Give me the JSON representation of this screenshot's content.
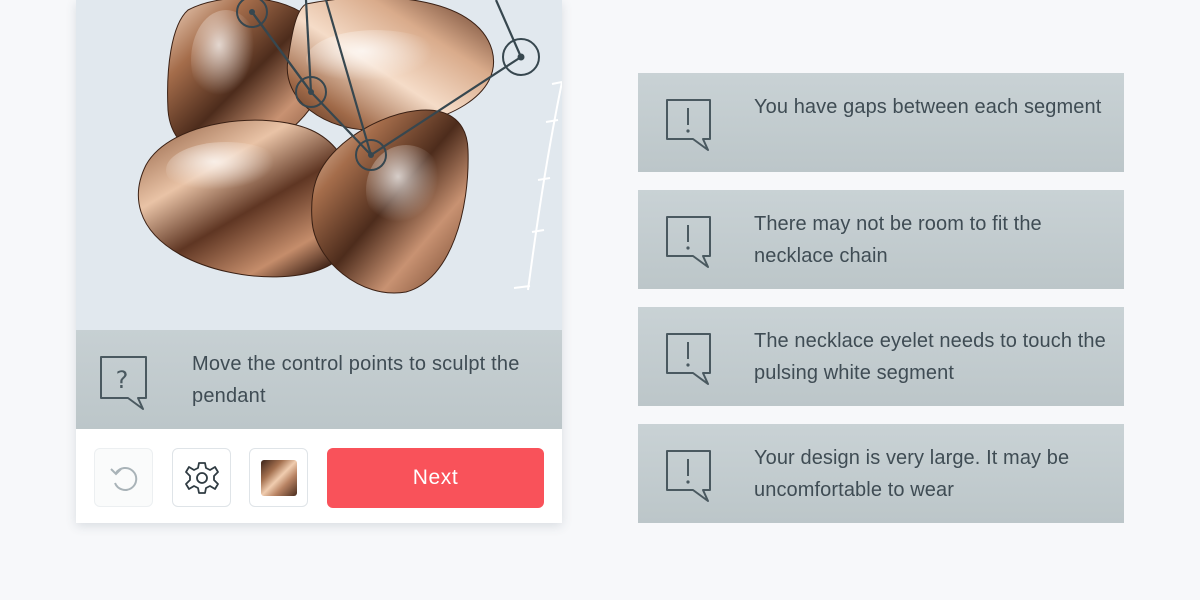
{
  "editor": {
    "hint": {
      "icon": "question-bubble-icon",
      "text": "Move the control points to sculpt the pendant"
    },
    "toolbar": {
      "undo_icon": "undo-icon",
      "settings_icon": "gear-icon",
      "material_icon": "rose-gold-material-swatch",
      "next_label": "Next",
      "next_color": "#f9525a"
    }
  },
  "alerts": [
    {
      "icon": "exclamation-bubble-icon",
      "text": "You have gaps between each segment"
    },
    {
      "icon": "exclamation-bubble-icon",
      "text": "There may not be room to fit the necklace chain"
    },
    {
      "icon": "exclamation-bubble-icon",
      "text": "The necklace eyelet needs to touch the pulsing white segment"
    },
    {
      "icon": "exclamation-bubble-icon",
      "text": "Your design is very large. It may be uncomfortable to wear"
    }
  ],
  "colors": {
    "page_background": "#f7f8fa",
    "panel_background": "#c4cdd0",
    "viewport_background": "#e1e8ee",
    "text": "#3f4c54"
  }
}
